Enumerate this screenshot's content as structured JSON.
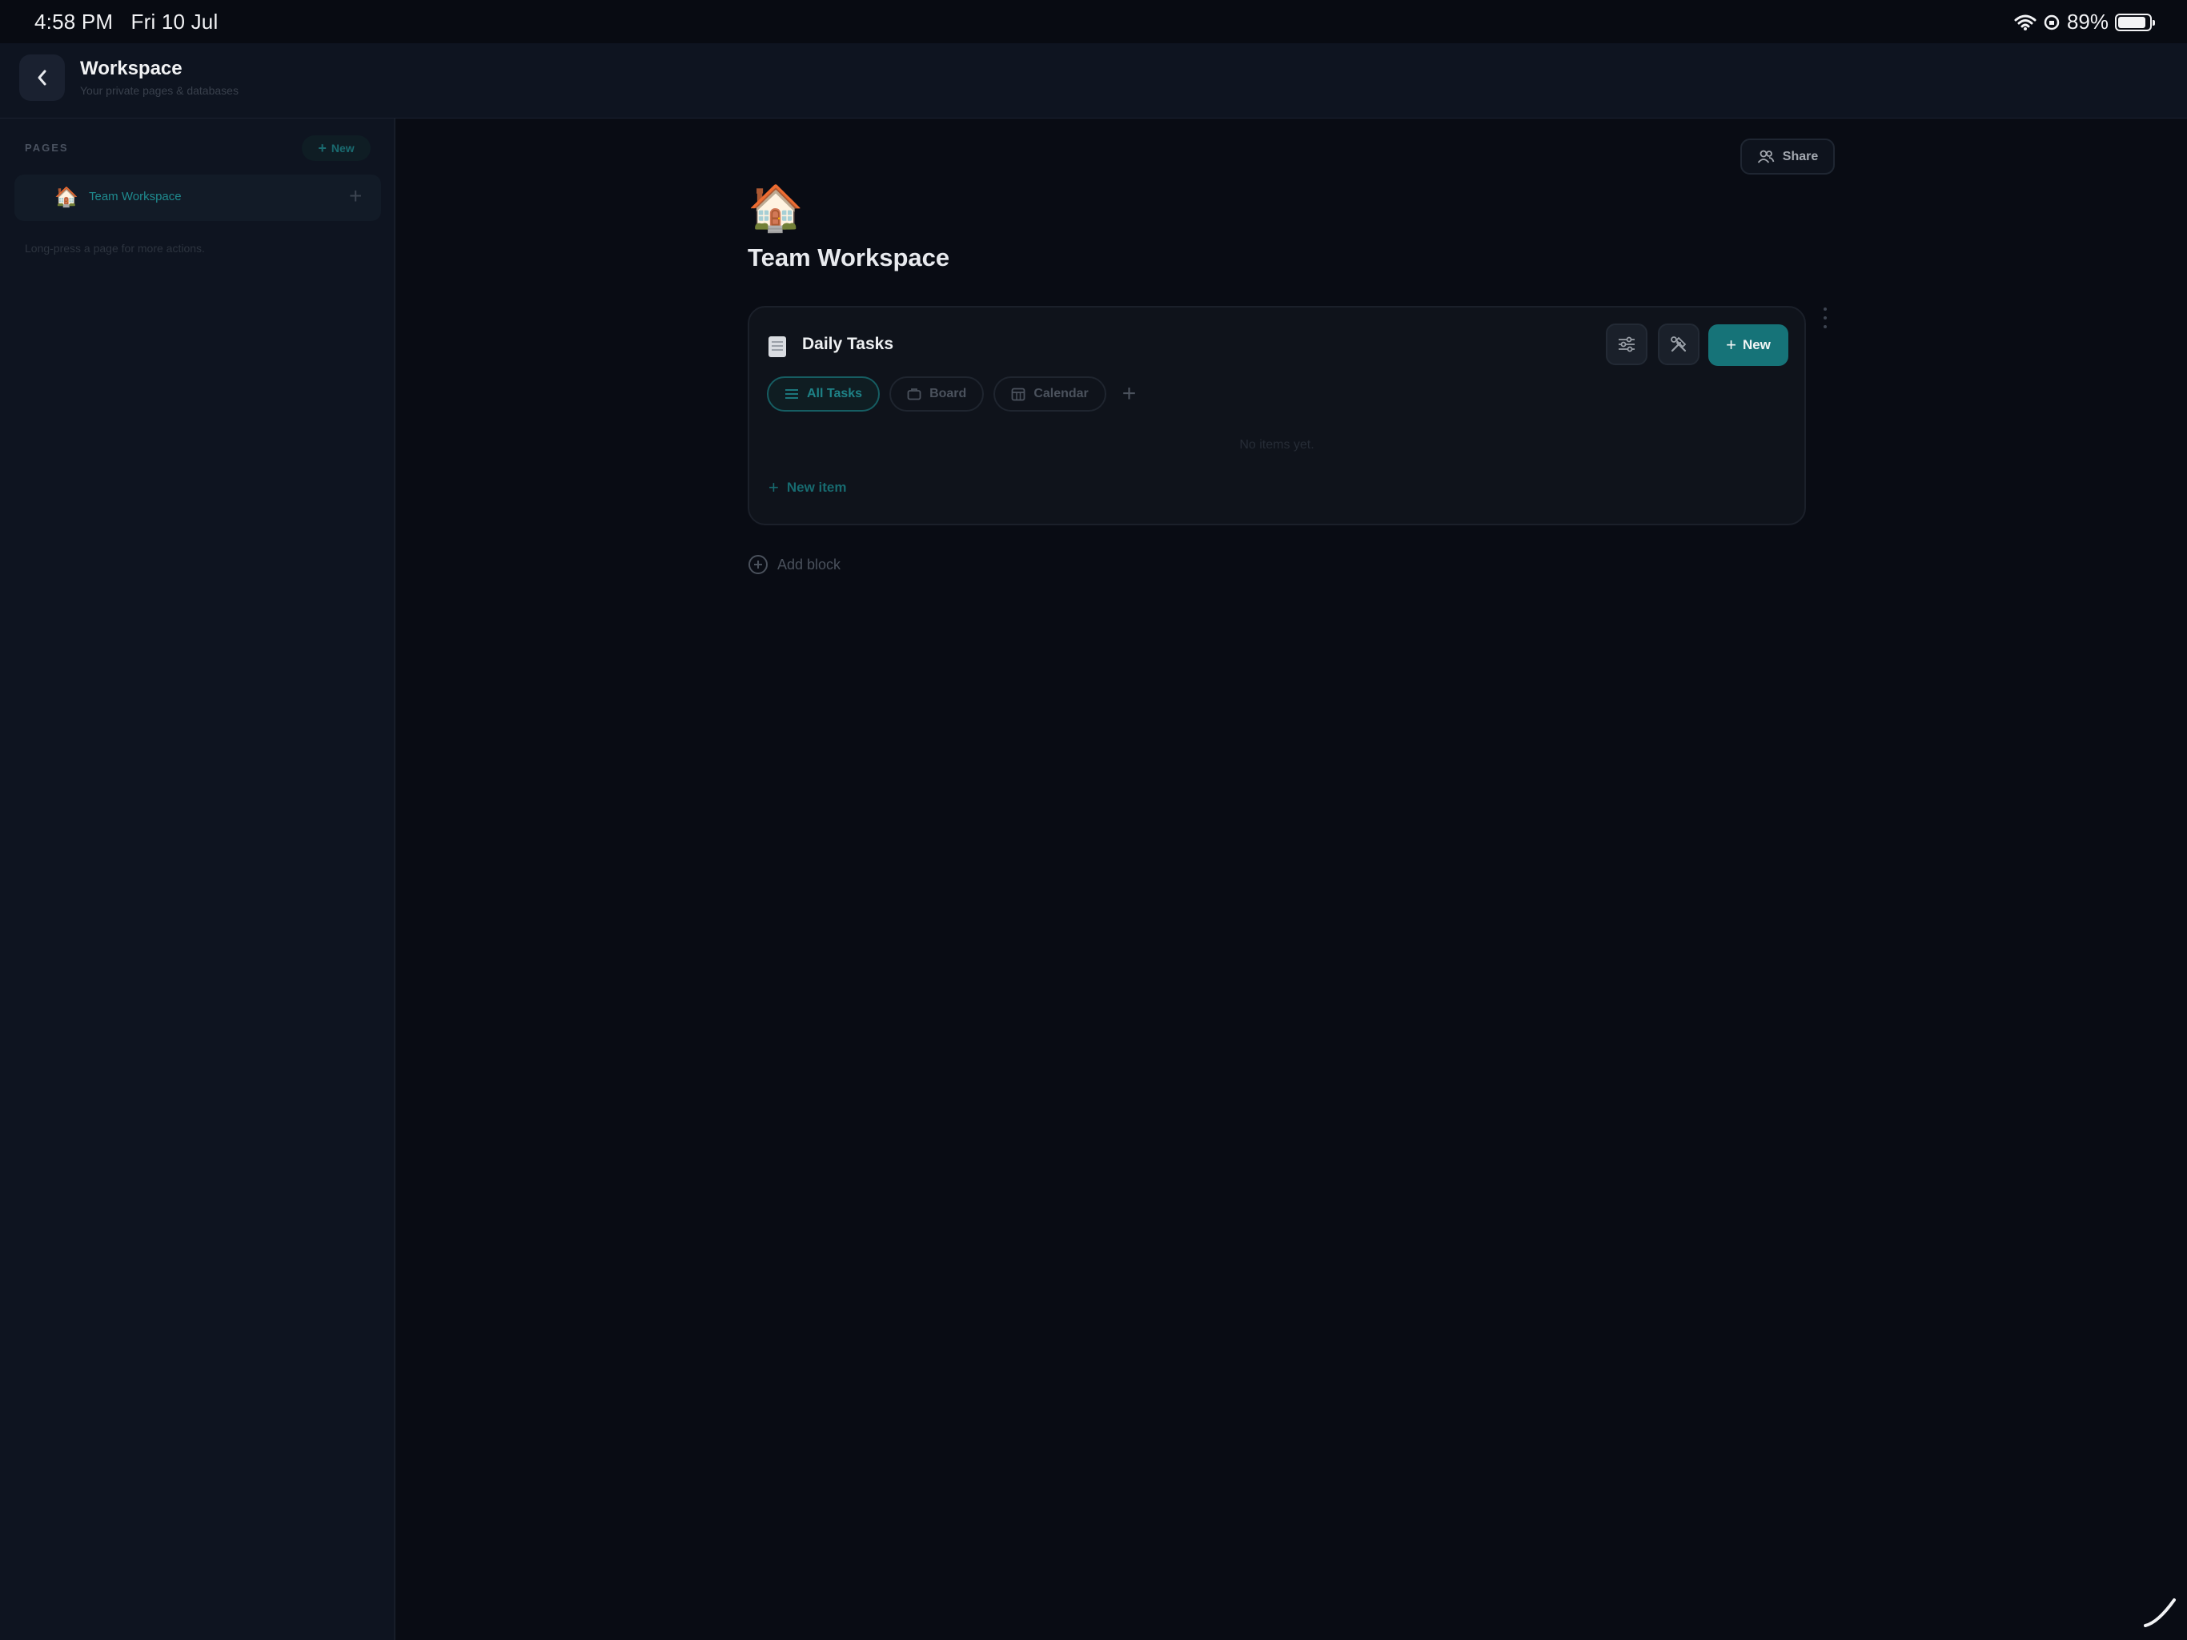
{
  "status_bar": {
    "time": "4:58 PM",
    "date": "Fri 10 Jul",
    "battery": "89%",
    "battery_level": 0.89
  },
  "header": {
    "title": "Workspace",
    "subtitle": "Your private pages & databases"
  },
  "sidebar": {
    "section_label": "PAGES",
    "new_label": "New",
    "pages": [
      {
        "emoji": "🏠",
        "label": "Team Workspace"
      }
    ],
    "hint": "Long-press a page for more actions."
  },
  "main": {
    "share_label": "Share",
    "page_emoji": "🏠",
    "page_title": "Team Workspace",
    "database": {
      "title": "Daily Tasks",
      "new_label": "New",
      "views": [
        {
          "label": "All Tasks",
          "icon": "list-icon",
          "active": true
        },
        {
          "label": "Board",
          "icon": "board-icon",
          "active": false
        },
        {
          "label": "Calendar",
          "icon": "calendar-icon",
          "active": false
        }
      ],
      "empty_text": "No items yet.",
      "new_item_label": "New item"
    },
    "add_block_label": "Add block"
  },
  "colors": {
    "accent": "#167378",
    "background": "#090c14",
    "sidebar": "#0e1420"
  }
}
